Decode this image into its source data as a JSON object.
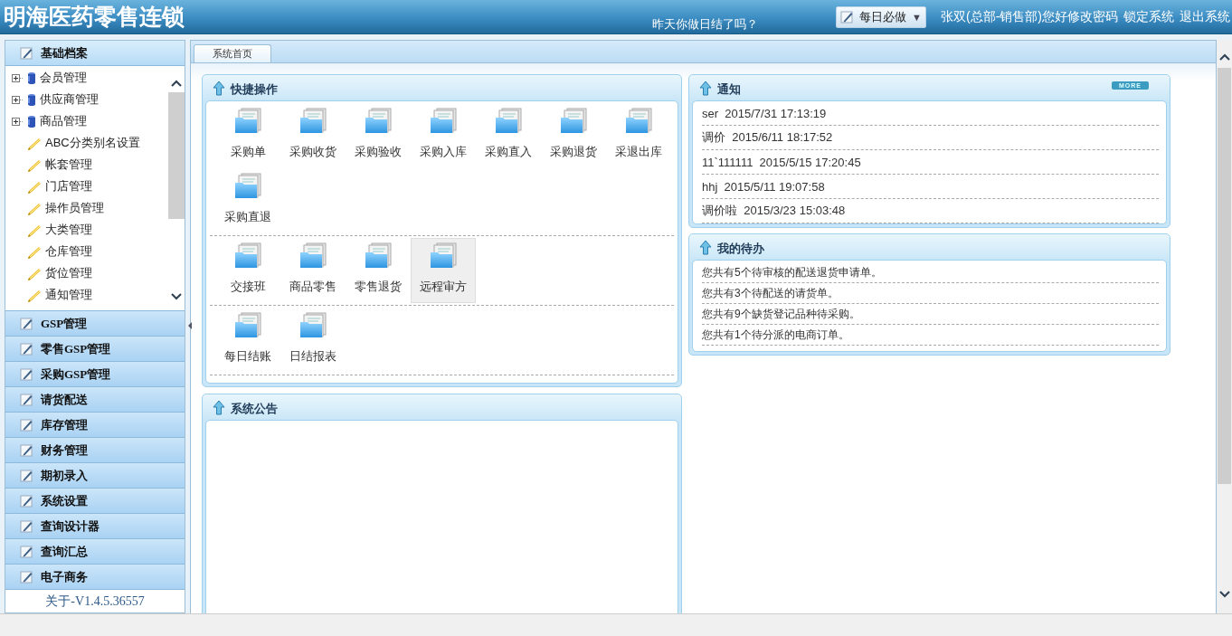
{
  "header": {
    "title": "明海医药零售连锁",
    "reminder": "昨天你做日结了吗？",
    "daily_button": {
      "label": "每日必做",
      "caret": "▼"
    },
    "user": "张双(总部-销售部)您好",
    "links": [
      "修改密码",
      "锁定系统",
      "退出系统"
    ]
  },
  "sidebar": {
    "sections": [
      {
        "label": "基础档案",
        "expanded": true,
        "children": [
          {
            "label": "会员管理",
            "kind": "folder"
          },
          {
            "label": "供应商管理",
            "kind": "folder"
          },
          {
            "label": "商品管理",
            "kind": "folder"
          },
          {
            "label": "ABC分类别名设置",
            "kind": "leaf"
          },
          {
            "label": "帐套管理",
            "kind": "leaf"
          },
          {
            "label": "门店管理",
            "kind": "leaf"
          },
          {
            "label": "操作员管理",
            "kind": "leaf"
          },
          {
            "label": "大类管理",
            "kind": "leaf"
          },
          {
            "label": "仓库管理",
            "kind": "leaf"
          },
          {
            "label": "货位管理",
            "kind": "leaf"
          },
          {
            "label": "通知管理",
            "kind": "leaf"
          }
        ]
      },
      {
        "label": "GSP管理",
        "expanded": false
      },
      {
        "label": "零售GSP管理",
        "expanded": false
      },
      {
        "label": "采购GSP管理",
        "expanded": false
      },
      {
        "label": "请货配送",
        "expanded": false
      },
      {
        "label": "库存管理",
        "expanded": false
      },
      {
        "label": "财务管理",
        "expanded": false
      },
      {
        "label": "期初录入",
        "expanded": false
      },
      {
        "label": "系统设置",
        "expanded": false
      },
      {
        "label": "查询设计器",
        "expanded": false
      },
      {
        "label": "查询汇总",
        "expanded": false
      },
      {
        "label": "电子商务",
        "expanded": false
      }
    ],
    "version": "关于-V1.4.5.36557"
  },
  "tabs": [
    {
      "label": "系统首页",
      "selected": true
    }
  ],
  "quick": {
    "title": "快捷操作",
    "groups": [
      {
        "items": [
          {
            "label": "采购单",
            "selected": false
          },
          {
            "label": "采购收货",
            "selected": false
          },
          {
            "label": "采购验收",
            "selected": false
          },
          {
            "label": "采购入库",
            "selected": false
          },
          {
            "label": "采购直入",
            "selected": false
          },
          {
            "label": "采购退货",
            "selected": false
          },
          {
            "label": "采退出库",
            "selected": false
          },
          {
            "label": "采购直退",
            "selected": false
          }
        ]
      },
      {
        "items": [
          {
            "label": "交接班",
            "selected": false
          },
          {
            "label": "商品零售",
            "selected": false
          },
          {
            "label": "零售退货",
            "selected": false
          },
          {
            "label": "远程审方",
            "selected": true
          }
        ]
      },
      {
        "items": [
          {
            "label": "每日结账",
            "selected": false
          },
          {
            "label": "日结报表",
            "selected": false
          }
        ]
      }
    ]
  },
  "notices": {
    "title": "通知",
    "more": "MORE",
    "items": [
      {
        "title": "ser",
        "time": "2015/7/31 17:13:19"
      },
      {
        "title": "调价",
        "time": "2015/6/11 18:17:52"
      },
      {
        "title": "11`111111",
        "time": "2015/5/15 17:20:45"
      },
      {
        "title": "hhj",
        "time": "2015/5/11 19:07:58"
      },
      {
        "title": "调价啦",
        "time": "2015/3/23 15:03:48"
      }
    ]
  },
  "todo": {
    "title": "我的待办",
    "items": [
      "您共有5个待审核的配送退货申请单。",
      "您共有3个待配送的请货单。",
      "您共有9个缺货登记品种待采购。",
      "您共有1个待分派的电商订单。"
    ]
  },
  "announcement": {
    "title": "系统公告"
  }
}
